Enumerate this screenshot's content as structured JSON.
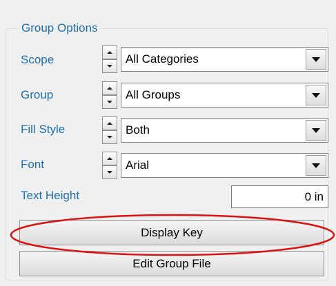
{
  "group_box": {
    "title": "Group Options"
  },
  "rows": [
    {
      "label": "Scope",
      "value": "All Categories"
    },
    {
      "label": "Group",
      "value": "All Groups"
    },
    {
      "label": "Fill Style",
      "value": "Both"
    },
    {
      "label": "Font",
      "value": "Arial"
    }
  ],
  "text_height": {
    "label": "Text Height",
    "value": "0 in"
  },
  "buttons": {
    "display_key": "Display Key",
    "edit_group_file": "Edit Group File"
  },
  "colors": {
    "label_blue": "#1e6fb4",
    "highlight_red": "#e01010"
  }
}
